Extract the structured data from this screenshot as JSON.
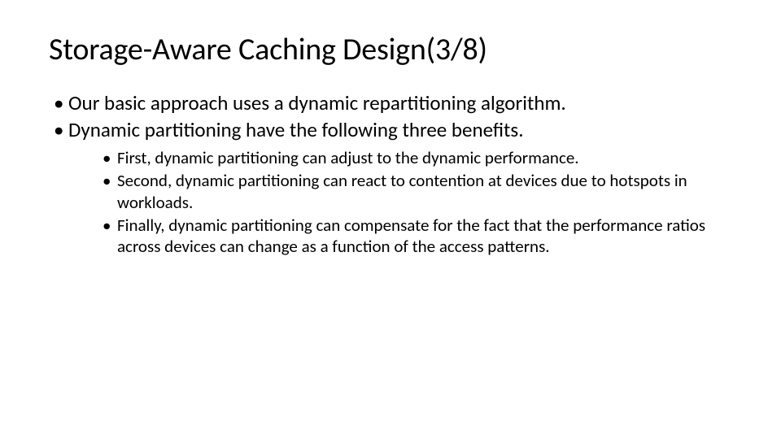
{
  "title": "Storage-Aware Caching Design(3/8)",
  "bullets": {
    "b0": "Our basic approach uses a dynamic repartitioning algorithm.",
    "b1": "Dynamic partitioning have the following three benefits.",
    "sub": {
      "s0": "First, dynamic partitioning can adjust to the dynamic performance.",
      "s1": "Second, dynamic partitioning can react to contention at devices due to hotspots in workloads.",
      "s2": "Finally, dynamic partitioning can compensate for the fact that the performance ratios across devices can change as a function of the access patterns."
    }
  }
}
